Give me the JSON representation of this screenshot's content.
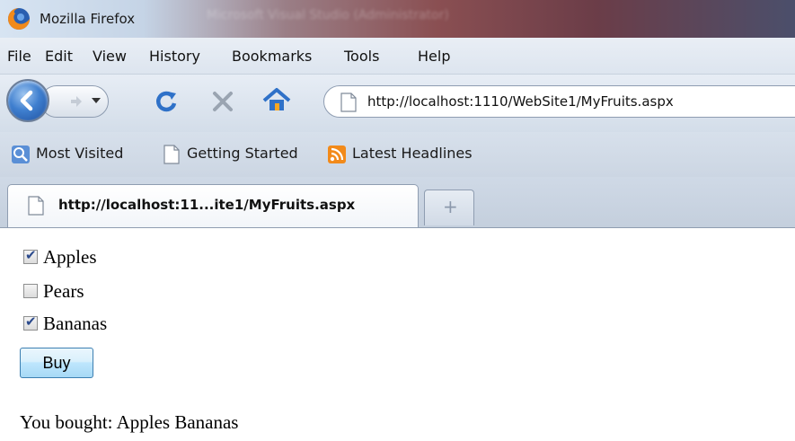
{
  "window": {
    "title": "Mozilla Firefox",
    "blurred_title": "Microsoft Visual Studio (Administrator)"
  },
  "menu": {
    "items": [
      {
        "label": "File"
      },
      {
        "label": "Edit"
      },
      {
        "label": "View"
      },
      {
        "label": "History"
      },
      {
        "label": "Bookmarks"
      },
      {
        "label": "Tools"
      },
      {
        "label": "Help"
      }
    ]
  },
  "navigation": {
    "url": "http://localhost:1110/WebSite1/MyFruits.aspx"
  },
  "bookmarks": {
    "items": [
      {
        "label": "Most Visited",
        "icon": "search-icon"
      },
      {
        "label": "Getting Started",
        "icon": "page-icon"
      },
      {
        "label": "Latest Headlines",
        "icon": "rss-icon"
      }
    ]
  },
  "tabs": {
    "active_label": "http://localhost:11...ite1/MyFruits.aspx",
    "new_tab_symbol": "+"
  },
  "page": {
    "fruits": [
      {
        "label": "Apples",
        "checked": true
      },
      {
        "label": "Pears",
        "checked": false
      },
      {
        "label": "Bananas",
        "checked": true
      }
    ],
    "buy_label": "Buy",
    "result": "You bought: Apples Bananas"
  },
  "colors": {
    "accent": "#3f7fcf",
    "toolbar": "#dde5ef"
  }
}
